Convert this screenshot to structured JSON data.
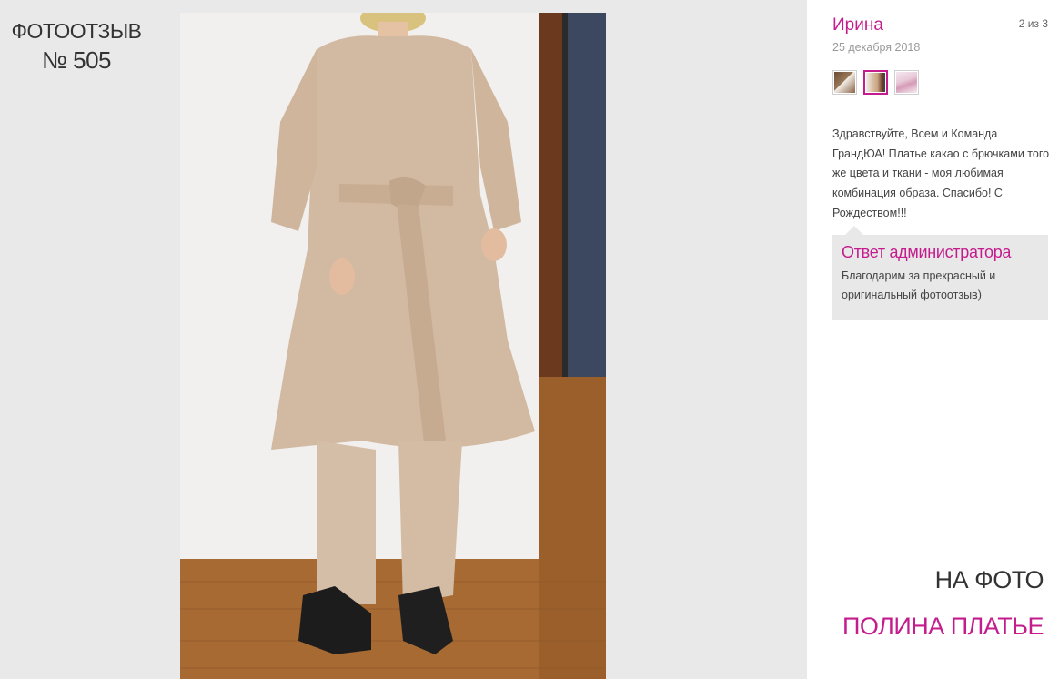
{
  "header": {
    "review_label": "ФОТООТЗЫВ",
    "review_number": "№ 505"
  },
  "review": {
    "author": "Ирина",
    "date": "25 декабря 2018",
    "counter": "2 из 3",
    "text": "Здравствуйте, Всем и Команда ГрандЮА! Платье какао с брючками того же цвета и ткани - моя любимая комбинация образа. Спасибо! С Рождеством!!!",
    "thumbnails": [
      {
        "name": "thumbnail-1",
        "active": false
      },
      {
        "name": "thumbnail-2",
        "active": true
      },
      {
        "name": "thumbnail-3",
        "active": false
      }
    ]
  },
  "admin_reply": {
    "title": "Ответ администратора",
    "text": "Благодарим за прекрасный и оригинальный фотоотзыв)"
  },
  "footer": {
    "on_photo_label": "НА ФОТО",
    "product_name": "ПОЛИНА ПЛАТЬЕ"
  },
  "colors": {
    "accent": "#c51c8d",
    "panel_bg": "#e9e9e9",
    "admin_bg": "#e8e8e8"
  }
}
